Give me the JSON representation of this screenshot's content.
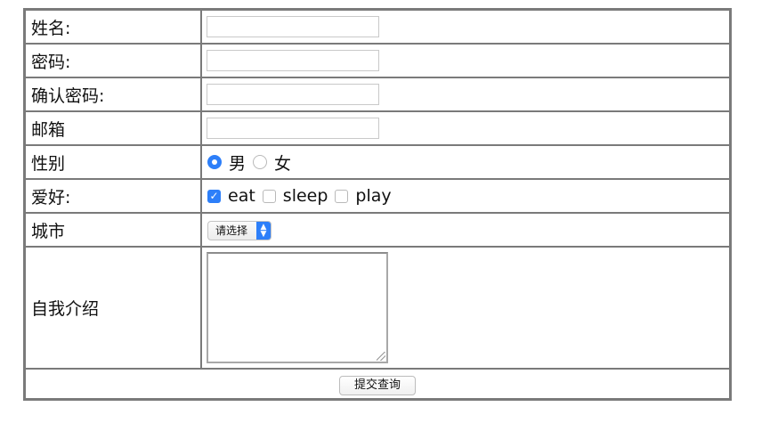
{
  "form": {
    "name_label": "姓名:",
    "password_label": "密码:",
    "confirm_password_label": "确认密码:",
    "email_label": "邮箱",
    "gender_label": "性别",
    "gender_options": [
      "男",
      "女"
    ],
    "gender_selected": "男",
    "hobby_label": "爱好:",
    "hobby_options": [
      "eat",
      "sleep",
      "play"
    ],
    "hobby_checked": [
      "eat"
    ],
    "city_label": "城市",
    "city_select_value": "请选择",
    "intro_label": "自我介绍",
    "submit_label": "提交查询"
  },
  "colors": {
    "accent": "#2d7ff9",
    "border": "#7a7a7a"
  }
}
